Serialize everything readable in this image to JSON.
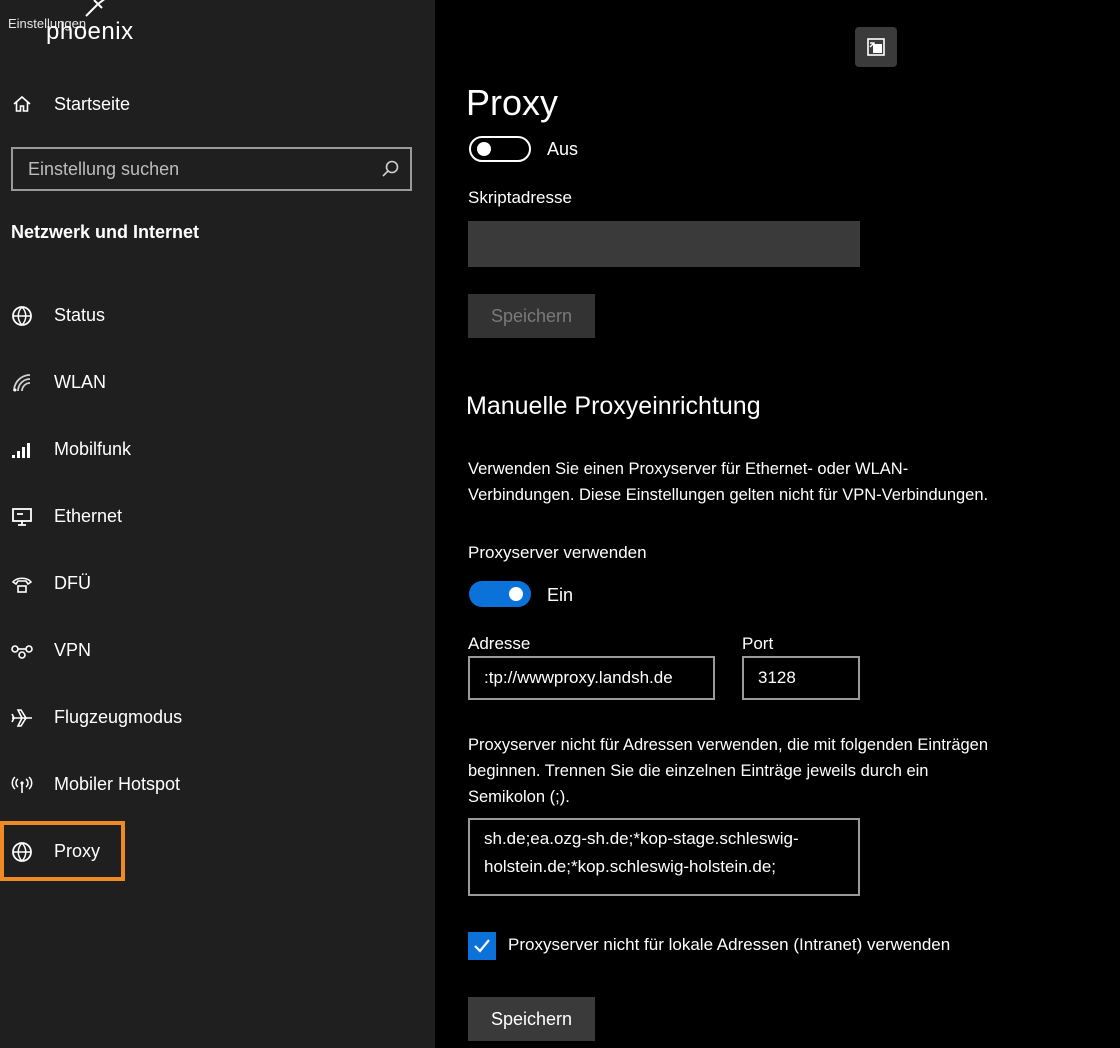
{
  "app": {
    "title": "Einstellungen",
    "watermark": "phoenix"
  },
  "sidebar": {
    "home_label": "Startseite",
    "search_placeholder": "Einstellung suchen",
    "section_title": "Netzwerk und Internet",
    "items": [
      {
        "label": "Status",
        "icon": "globe-status-icon"
      },
      {
        "label": "WLAN",
        "icon": "wifi-icon"
      },
      {
        "label": "Mobilfunk",
        "icon": "cellular-signal-icon"
      },
      {
        "label": "Ethernet",
        "icon": "ethernet-monitor-icon"
      },
      {
        "label": "DFÜ",
        "icon": "dialup-phone-icon"
      },
      {
        "label": "VPN",
        "icon": "vpn-icon"
      },
      {
        "label": "Flugzeugmodus",
        "icon": "airplane-icon"
      },
      {
        "label": "Mobiler Hotspot",
        "icon": "hotspot-icon"
      },
      {
        "label": "Proxy",
        "icon": "globe-icon",
        "active": true
      }
    ]
  },
  "main": {
    "title": "Proxy",
    "auto_toggle_label": "Aus",
    "script_address_label": "Skriptadresse",
    "script_address_value": "",
    "save_label_disabled": "Speichern",
    "manual_heading": "Manuelle Proxyeinrichtung",
    "manual_desc_line1": "Verwenden Sie einen Proxyserver für Ethernet- oder WLAN-",
    "manual_desc_line2": "Verbindungen. Diese Einstellungen gelten nicht für VPN-Verbindungen.",
    "use_proxy_label": "Proxyserver verwenden",
    "use_proxy_toggle_label": "Ein",
    "address_label": "Adresse",
    "address_value": ":tp://wwwproxy.landsh.de",
    "port_label": "Port",
    "port_value": "3128",
    "exceptions_line1": "Proxyserver nicht für Adressen verwenden, die mit folgenden Einträgen",
    "exceptions_line2": "beginnen. Trennen Sie die einzelnen Einträge jeweils durch ein",
    "exceptions_line3": "Semikolon (;).",
    "exceptions_text_line1": "sh.de;ea.ozg-sh.de;*kop-stage.schleswig-",
    "exceptions_text_line2": "holstein.de;*kop.schleswig-holstein.de;",
    "local_checkbox_label": "Proxyserver nicht für lokale Adressen (Intranet) verwenden",
    "save_label": "Speichern"
  },
  "colors": {
    "accent": "#0a72d8",
    "highlight": "#f08a24",
    "sidebar_bg": "#1f1f1f",
    "main_bg": "#000000"
  }
}
